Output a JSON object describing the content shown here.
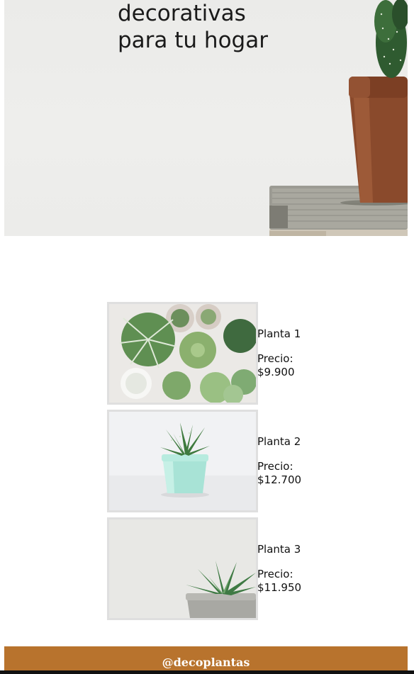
{
  "hero": {
    "title_line1": "decorativas",
    "title_line2": "para tu hogar",
    "image_icon": "cactus-pot-books-image"
  },
  "products": [
    {
      "name": "Planta 1",
      "price_label": "Precio:",
      "price": "$9.900",
      "image_icon": "succulents-assortment-image"
    },
    {
      "name": "Planta 2",
      "price_label": "Precio:",
      "price": "$12.700",
      "image_icon": "aloe-mint-pot-image"
    },
    {
      "name": "Planta 3",
      "price_label": "Precio:",
      "price": "$11.950",
      "image_icon": "succulent-gray-pot-image"
    }
  ],
  "footer": {
    "handle": "@decoplantas"
  },
  "colors": {
    "footer_bg": "#b8732d",
    "pot": "#8a4a2c",
    "plant_green": "#4e8a4c"
  }
}
